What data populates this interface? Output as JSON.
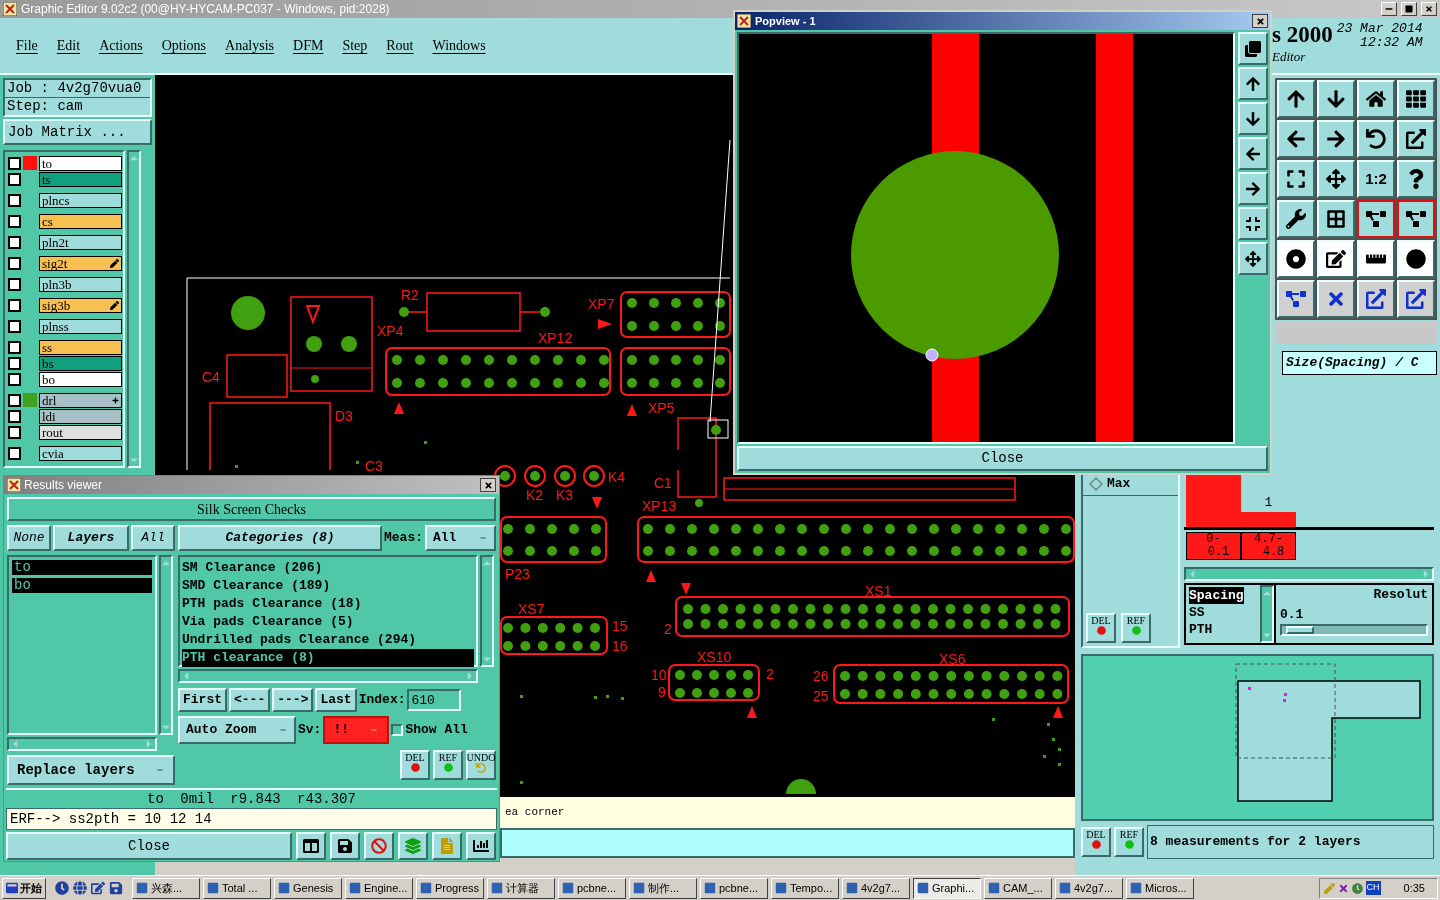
{
  "main_window": {
    "title": "Graphic Editor 9.02c2 (00@HY-HYCAM-PC037 - Windows, pid:2028)"
  },
  "menu": [
    "File",
    "Edit",
    "Actions",
    "Options",
    "Analysis",
    "DFM",
    "Step",
    "Rout",
    "Windows"
  ],
  "header": {
    "product": "s 2000",
    "date": "23 Mar 2014",
    "time": "12:32 AM",
    "subtitle": "Editor"
  },
  "job": {
    "job": "Job : 4v2g70vua0",
    "step": "Step: cam",
    "matrix_button": "Job Matrix ..."
  },
  "layer_groups": [
    [
      {
        "name": "to",
        "color": "#ffffff",
        "swatch": {
          "color": "#ff1010"
        },
        "checked": false,
        "affected": false,
        "expandable": false
      },
      {
        "name": "ts",
        "color": "#10a080",
        "checked": false,
        "affected": false,
        "expandable": false
      }
    ],
    [
      {
        "name": "plncs",
        "color": "#a0dcdc",
        "checked": false,
        "affected": false,
        "expandable": false
      }
    ],
    [
      {
        "name": "cs",
        "color": "#f8c050",
        "checked": false,
        "affected": false,
        "expandable": false
      }
    ],
    [
      {
        "name": "pln2t",
        "color": "#a0dcdc",
        "checked": false,
        "affected": false,
        "expandable": false
      }
    ],
    [
      {
        "name": "sig2t",
        "color": "#f8c050",
        "checked": false,
        "affected": true,
        "expandable": false
      }
    ],
    [
      {
        "name": "pln3b",
        "color": "#a0dcdc",
        "checked": false,
        "affected": false,
        "expandable": false
      }
    ],
    [
      {
        "name": "sig3b",
        "color": "#f8c050",
        "checked": false,
        "affected": true,
        "expandable": false
      }
    ],
    [
      {
        "name": "plnss",
        "color": "#a0dcdc",
        "checked": false,
        "affected": false,
        "expandable": false
      }
    ],
    [
      {
        "name": "ss",
        "color": "#f8c050",
        "checked": false,
        "affected": false,
        "expandable": false
      },
      {
        "name": "bs",
        "color": "#10a080",
        "checked": false,
        "affected": false,
        "expandable": false
      },
      {
        "name": "bo",
        "color": "#ffffff",
        "checked": false,
        "affected": false,
        "expandable": false
      }
    ],
    [
      {
        "name": "drl",
        "color": "#a8c0c8",
        "swatch": {
          "color": "#40a020"
        },
        "checked": false,
        "affected": false,
        "expandable": true
      },
      {
        "name": "ldi",
        "color": "#a8c0c8",
        "checked": false,
        "affected": false,
        "expandable": false
      },
      {
        "name": "rout",
        "color": "#e0e0e0",
        "checked": false,
        "affected": false,
        "expandable": false
      }
    ],
    [
      {
        "name": "cvia",
        "color": "#a0dcdc",
        "checked": false,
        "affected": false,
        "expandable": false
      }
    ]
  ],
  "pcb_labels": [
    "R2",
    "XP7",
    "XP4",
    "XP12",
    "C4",
    "D3",
    "XP5",
    "C3",
    "K2",
    "K3",
    "K4",
    "C1",
    "XP13",
    "P23",
    "XS7",
    "15",
    "16",
    "XS1",
    "2",
    "XS10",
    "10",
    "9",
    "2",
    "XS6",
    "26",
    "25"
  ],
  "message": "ea corner",
  "popview": {
    "title": "Popview - 1",
    "close": "Close"
  },
  "tools": [
    {
      "selected": false
    },
    {
      "selected": false
    },
    {
      "selected": false
    },
    {
      "selected": false
    },
    {
      "selected": false
    },
    {
      "selected": false
    },
    {
      "selected": false
    },
    {
      "selected": false
    },
    {
      "selected": false
    },
    {
      "selected": false
    },
    {
      "selected": false,
      "label": "1:2"
    },
    {
      "selected": false
    },
    {
      "selected": false
    },
    {
      "selected": false
    },
    {
      "selected": true
    },
    {
      "selected": true
    },
    {
      "selected": false
    },
    {
      "selected": false
    },
    {
      "selected": false
    },
    {
      "selected": false
    },
    {
      "selected": false
    },
    {
      "selected": false
    },
    {
      "selected": false
    },
    {
      "selected": false
    }
  ],
  "measure_panel": {
    "size_field": "Size(Spacing) / C",
    "max_option": {
      "label": "Max",
      "selected": false
    },
    "bins": [
      {
        "from": "0-",
        "to": "0.1"
      },
      {
        "from": "4.7-",
        "to": "4.8",
        "count": "1"
      }
    ],
    "measures": [
      {
        "name": "Spacing",
        "selected": true
      },
      {
        "name": "SS",
        "selected": false
      },
      {
        "name": "PTH",
        "selected": false
      }
    ],
    "resolution": {
      "label": "Resolut",
      "value": "0.1"
    },
    "upper_actions": [
      "DEL",
      "REF"
    ],
    "lower_actions": [
      "DEL",
      "REF"
    ],
    "status": "8 measurements for 2 layers"
  },
  "results_viewer": {
    "title": "Results viewer",
    "header": "Silk Screen Checks",
    "layer_buttons": [
      "None",
      "Layers",
      "All"
    ],
    "layers": [
      {
        "name": "to",
        "selected": true
      },
      {
        "name": "bo",
        "selected": true
      }
    ],
    "replace": "Replace layers",
    "categories_button": "Categories (8)",
    "meas_label": "Meas:",
    "meas_value": "All",
    "categories": [
      {
        "name": "SM Clearance (206)",
        "selected": false
      },
      {
        "name": "SMD Clearance (189)",
        "selected": false
      },
      {
        "name": "PTH pads Clearance (18)",
        "selected": false
      },
      {
        "name": "Via pads Clearance (5)",
        "selected": false
      },
      {
        "name": "Undrilled pads Clearance (294)",
        "selected": false
      },
      {
        "name": "PTH clearance (8)",
        "selected": true
      }
    ],
    "nav": [
      "First",
      "<---",
      "--->",
      "Last"
    ],
    "index_label": "Index:",
    "index_value": "610",
    "zoom": "Auto Zoom",
    "sv_label": "Sv:",
    "sv_value": "!!",
    "show_all": {
      "label": "Show All",
      "checked": false
    },
    "actions": [
      "DEL",
      "REF",
      "UNDO"
    ],
    "info": "to 0mil r9.843 r43.307",
    "erf": "ERF--> ss2pth = 10 12 14",
    "close": "Close"
  },
  "taskbar": {
    "start": "开始",
    "tasks": [
      {
        "label": "兴森...",
        "selected": false
      },
      {
        "label": "Total ...",
        "selected": false
      },
      {
        "label": "Genesis",
        "selected": false
      },
      {
        "label": "Engine...",
        "selected": false
      },
      {
        "label": "Progress",
        "selected": false
      },
      {
        "label": "计算器",
        "selected": false
      },
      {
        "label": "pcbne...",
        "selected": false
      },
      {
        "label": "制作...",
        "selected": false
      },
      {
        "label": "pcbne...",
        "selected": false
      },
      {
        "label": "Tempo...",
        "selected": false
      },
      {
        "label": "4v2g7...",
        "selected": false
      },
      {
        "label": "Graphi...",
        "selected": true
      },
      {
        "label": "CAM_...",
        "selected": false
      },
      {
        "label": "4v2g7...",
        "selected": false
      },
      {
        "label": "Micros...",
        "selected": false
      }
    ],
    "language": "CH",
    "clock": "0:35"
  }
}
